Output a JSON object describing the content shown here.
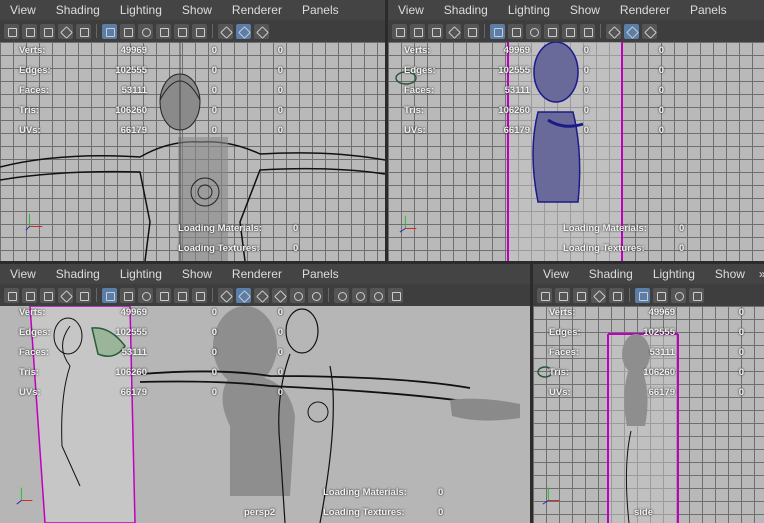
{
  "menu": [
    "View",
    "Shading",
    "Lighting",
    "Show",
    "Renderer",
    "Panels"
  ],
  "menu_small": [
    "View",
    "Shading",
    "Lighting",
    "Show"
  ],
  "more_indicator": "»",
  "hud": {
    "labels": [
      "Verts:",
      "Edges:",
      "Faces:",
      "Tris:",
      "UVs:"
    ],
    "col1": [
      "49969",
      "102555",
      "53111",
      "106260",
      "66179"
    ],
    "col2": [
      "0",
      "0",
      "0",
      "0",
      "0"
    ],
    "col3": [
      "0",
      "0",
      "0",
      "0",
      "0"
    ]
  },
  "loading": {
    "materials_label": "Loading Materials:",
    "materials_value": "0",
    "textures_label": "Loading Textures:",
    "textures_value": "0"
  },
  "panels": {
    "top_left": {
      "camera": ""
    },
    "top_right": {
      "camera": ""
    },
    "bottom_left": {
      "camera": "persp2"
    },
    "bottom_right": {
      "camera": "side"
    }
  },
  "colors": {
    "panel_bg": "#444444",
    "viewport_bg": "#b9b9b9",
    "grid": "#6f6f6f",
    "highlight_wire": "#1a1a8a",
    "toggle_on": "#5a7ea8",
    "image_plane_border": "#c000c0"
  },
  "icons": [
    "select-tool-icon",
    "lasso-icon",
    "paint-icon",
    "move-icon",
    "rotate-icon",
    "grid-icon",
    "film-gate-icon",
    "resolution-gate-icon",
    "wireframe-icon",
    "smooth-shade-icon",
    "textured-icon",
    "lights-icon",
    "shadows-icon",
    "isolate-icon",
    "xray-icon"
  ]
}
